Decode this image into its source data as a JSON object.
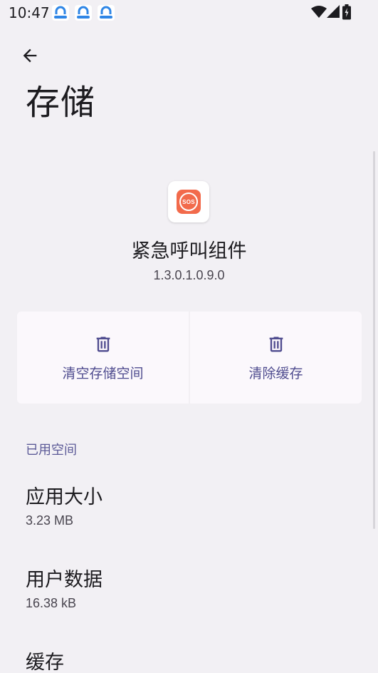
{
  "status_bar": {
    "time": "10:47",
    "notification_icons": [
      "app-notification-icon",
      "app-notification-icon",
      "app-notification-icon"
    ],
    "system_icons": [
      "wifi-icon",
      "signal-icon",
      "battery-icon"
    ]
  },
  "header": {
    "back_icon": "arrow-back-icon",
    "title": "存储"
  },
  "app": {
    "icon": "sos-icon",
    "icon_text": "SOS",
    "name": "紧急呼叫组件",
    "version": "1.3.0.1.0.9.0"
  },
  "actions": [
    {
      "icon": "trash-icon",
      "label": "清空存储空间"
    },
    {
      "icon": "trash-icon",
      "label": "清除缓存"
    }
  ],
  "section": {
    "title": "已用空间",
    "items": [
      {
        "title": "应用大小",
        "summary": "3.23 MB"
      },
      {
        "title": "用户数据",
        "summary": "16.38 kB"
      },
      {
        "title": "缓存",
        "summary": ""
      }
    ]
  },
  "colors": {
    "background": "#f2f0f4",
    "accent": "#4f4c8f",
    "card": "#fbf8fc",
    "sos": "#f26a4b",
    "notification_blue": "#2f86e6"
  }
}
